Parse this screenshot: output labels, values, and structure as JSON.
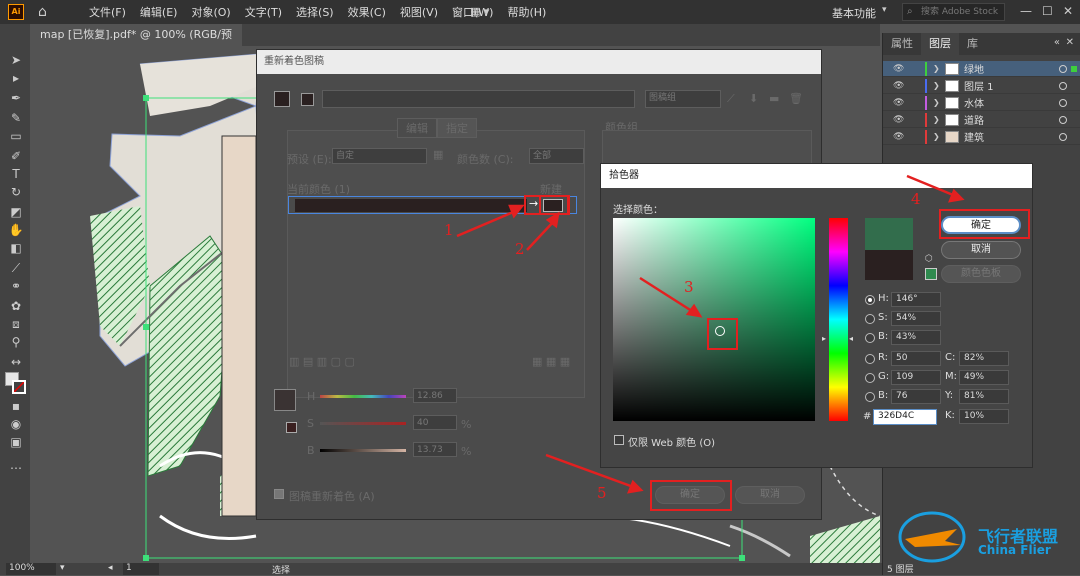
{
  "app": {
    "logo": "Ai",
    "menus": [
      "文件(F)",
      "编辑(E)",
      "对象(O)",
      "文字(T)",
      "选择(S)",
      "效果(C)",
      "视图(V)",
      "窗口(W)",
      "帮助(H)"
    ],
    "workspace": "基本功能",
    "search_placeholder": "搜索 Adobe Stock",
    "doc_tab": "map [已恢复].pdf* @ 100% (RGB/预览)"
  },
  "layers_panel": {
    "tabs": [
      "属性",
      "图层",
      "库"
    ],
    "active_tab": "图层",
    "layers": [
      {
        "name": "绿地",
        "color": "#3ecf3e",
        "selected": true
      },
      {
        "name": "图层 1",
        "color": "#4a6cf0",
        "selected": false
      },
      {
        "name": "水体",
        "color": "#c35ce0",
        "selected": false
      },
      {
        "name": "道路",
        "color": "#e03a3a",
        "selected": false
      },
      {
        "name": "建筑",
        "color": "#e03a3a",
        "selected": false
      }
    ],
    "footer": "5 图层"
  },
  "status_bar": {
    "zoom": "100%",
    "artboard": "1",
    "tool": "选择"
  },
  "recolor_dialog": {
    "title": "重新着色图稿",
    "group_placeholder": "图稿组",
    "tabs": [
      "编辑",
      "指定"
    ],
    "preset_label": "预设 (E):",
    "preset_value": "自定",
    "colors_label": "颜色数 (C):",
    "colors_value": "全部",
    "current_label": "当前颜色 (1)",
    "new_label": "新建",
    "color_group_label": "颜色组",
    "h_label": "H",
    "s_label": "S",
    "b_label": "B",
    "h_value": "12.86",
    "s_value": "40",
    "b_value": "13.73",
    "percent": "%",
    "recolor_checkbox": "图稿重新着色 (A)",
    "ok": "确定",
    "cancel": "取消"
  },
  "color_picker": {
    "title": "拾色器",
    "select_label": "选择颜色：",
    "ok": "确定",
    "cancel": "取消",
    "swatches": "颜色色板",
    "H": "146°",
    "S": "54%",
    "B": "43%",
    "R": "50",
    "G": "109",
    "Bv": "76",
    "hex": "326D4C",
    "C": "82%",
    "M": "49%",
    "Y": "81%",
    "K": "10%",
    "web_only": "仅限 Web 颜色 (O)",
    "new_color": "#326d4c",
    "old_color": "#2a2020"
  },
  "annotations": [
    "1",
    "2",
    "3",
    "4",
    "5"
  ],
  "watermark": {
    "title": "飞行者联盟",
    "subtitle": "China Flier"
  }
}
